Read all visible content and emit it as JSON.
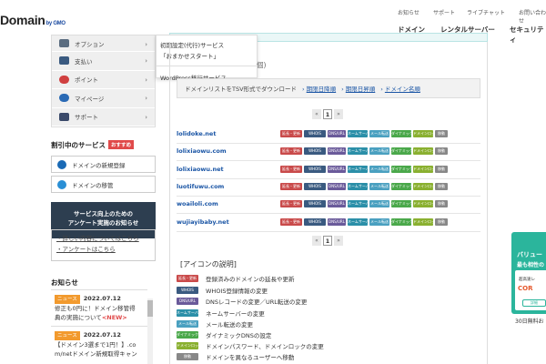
{
  "header": {
    "logo": "Domain",
    "logo_sub": "by GMO",
    "util_links": [
      "お知らせ",
      "サポート",
      "ライブチャット",
      "お問い合わせ"
    ],
    "global_nav": [
      "ドメイン",
      "レンタルサーバー",
      "セキュリティ"
    ]
  },
  "sidebar": {
    "menu": [
      {
        "label": "オプション",
        "icon": "option-icon",
        "color": "#5a6c80"
      },
      {
        "label": "支払い",
        "icon": "wallet-icon",
        "color": "#3a5a80"
      },
      {
        "label": "ポイント",
        "icon": "point-icon",
        "color": "#d04040"
      },
      {
        "label": "マイページ",
        "icon": "person-icon",
        "color": "#2a6ab5"
      },
      {
        "label": "サポート",
        "icon": "mail-icon",
        "color": "#3a4a6a"
      }
    ],
    "dropdown": [
      "初期設定(代行)サービス",
      "「おまかせスタート」",
      "WordPress移行サービス"
    ],
    "discount_heading": "割引中のサービス",
    "discount_badge": "おすすめ",
    "services": [
      "ドメインの新規登録",
      "ドメインの移管"
    ],
    "notice_title_1": "サービス向上のための",
    "notice_title_2": "アンケート実施のお知らせ",
    "notice_links": [
      "・詳しい内容についてはこちら",
      "・アンケートはこちら"
    ],
    "news_heading": "お知らせ",
    "news": [
      {
        "tag": "ニュース",
        "date": "2022.07.12",
        "text": "修正も0円に！ドメイン移管得",
        "text2": "典の実施について",
        "new": "<NEW>"
      },
      {
        "tag": "ニュース",
        "date": "2022.07.12",
        "text": "【ドメイン3選まで1円！】.co",
        "text2": "m/netドメイン新規取得キャン",
        "new": ""
      }
    ]
  },
  "main": {
    "title_fragment": "個)",
    "download_text": "ドメインリストをTSV形式でダウンロード",
    "download_links": [
      "期限日降順",
      "期限日昇順",
      "ドメイン名順"
    ],
    "pager": {
      "prev": "«",
      "current": "1",
      "next": "»"
    },
    "domains": [
      "lolidoke.net",
      "lolixiaowu.com",
      "lolixiaowu.net",
      "luotifuwu.com",
      "woailoli.com",
      "wujiayibaby.net"
    ],
    "action_buttons": [
      {
        "label": "延長・更新",
        "color": "#c94a4a"
      },
      {
        "label": "WHOIS",
        "color": "#3a5a80"
      },
      {
        "label": "DNS/URL",
        "color": "#6a5a9a"
      },
      {
        "label": "ネームサーバー",
        "color": "#2b8fa8"
      },
      {
        "label": "メール転送",
        "color": "#4aa0c0"
      },
      {
        "label": "ダイナミック",
        "color": "#4aa84a"
      },
      {
        "label": "ドメインロック",
        "color": "#8ab030"
      },
      {
        "label": "移動",
        "color": "#888888"
      }
    ],
    "legend_heading": "[アイコンの説明]",
    "legend": [
      {
        "label": "延長・更新",
        "desc": "登録済みのドメインの延長や更新",
        "color": "#c94a4a"
      },
      {
        "label": "WHOIS",
        "desc": "WHOIS登録情報の変更",
        "color": "#3a5a80"
      },
      {
        "label": "DNS/URL",
        "desc": "DNSレコードの変更／URL転送の変更",
        "color": "#6a5a9a"
      },
      {
        "label": "ネームサーバー",
        "desc": "ネームサーバーの変更",
        "color": "#2b8fa8"
      },
      {
        "label": "メール転送",
        "desc": "メール転送の変更",
        "color": "#4aa0c0"
      },
      {
        "label": "ダイナミック",
        "desc": "ダイナミックDNSの設定",
        "color": "#4aa84a"
      },
      {
        "label": "ドメインロック",
        "desc": "ドメインパスワード、ドメインロックの変更",
        "color": "#8ab030"
      },
      {
        "label": "移動",
        "desc": "ドメインを異なるユーザーへ移動",
        "color": "#888888"
      }
    ]
  },
  "promo": {
    "t1": "バリュー",
    "t2": "最も相性の",
    "t3": "超高速レ",
    "company": "COR",
    "btn": "詳細",
    "bottom": "30日無料お"
  }
}
